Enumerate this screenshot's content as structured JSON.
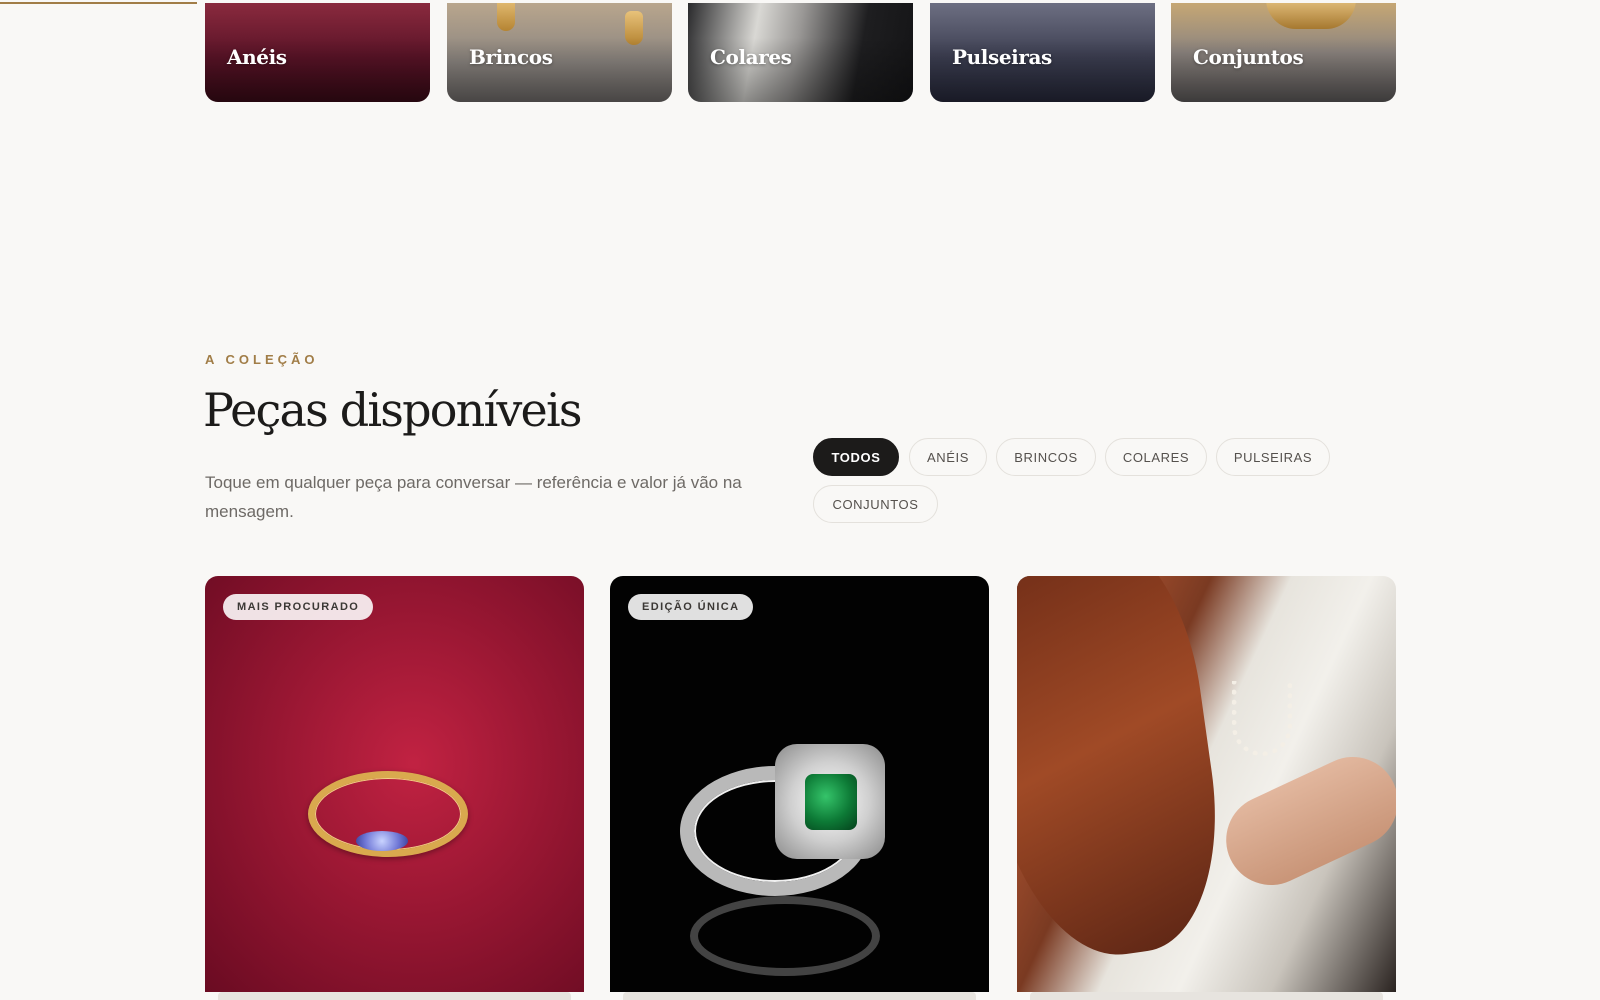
{
  "categories": [
    {
      "label": "Anéis"
    },
    {
      "label": "Brincos"
    },
    {
      "label": "Colares"
    },
    {
      "label": "Pulseiras"
    },
    {
      "label": "Conjuntos"
    }
  ],
  "section": {
    "eyebrow": "A COLEÇÃO",
    "title": "Peças disponíveis",
    "description": "Toque em qualquer peça para conversar — referência e valor já vão na mensagem."
  },
  "filters": {
    "active": "TODOS",
    "items": [
      "TODOS",
      "ANÉIS",
      "BRINCOS",
      "COLARES",
      "PULSEIRAS",
      "CONJUNTOS"
    ]
  },
  "products": [
    {
      "badge": "MAIS PROCURADO",
      "image": "gold-ring-on-red-fabric"
    },
    {
      "badge": "EDIÇÃO ÚNICA",
      "image": "silver-emerald-ring-on-black"
    },
    {
      "badge": "",
      "image": "woman-wearing-pearl-necklace"
    }
  ],
  "colors": {
    "accent": "#a17d47",
    "background": "#f9f8f6",
    "text": "#1c1b1a",
    "active_filter": "#1c1b1a"
  }
}
